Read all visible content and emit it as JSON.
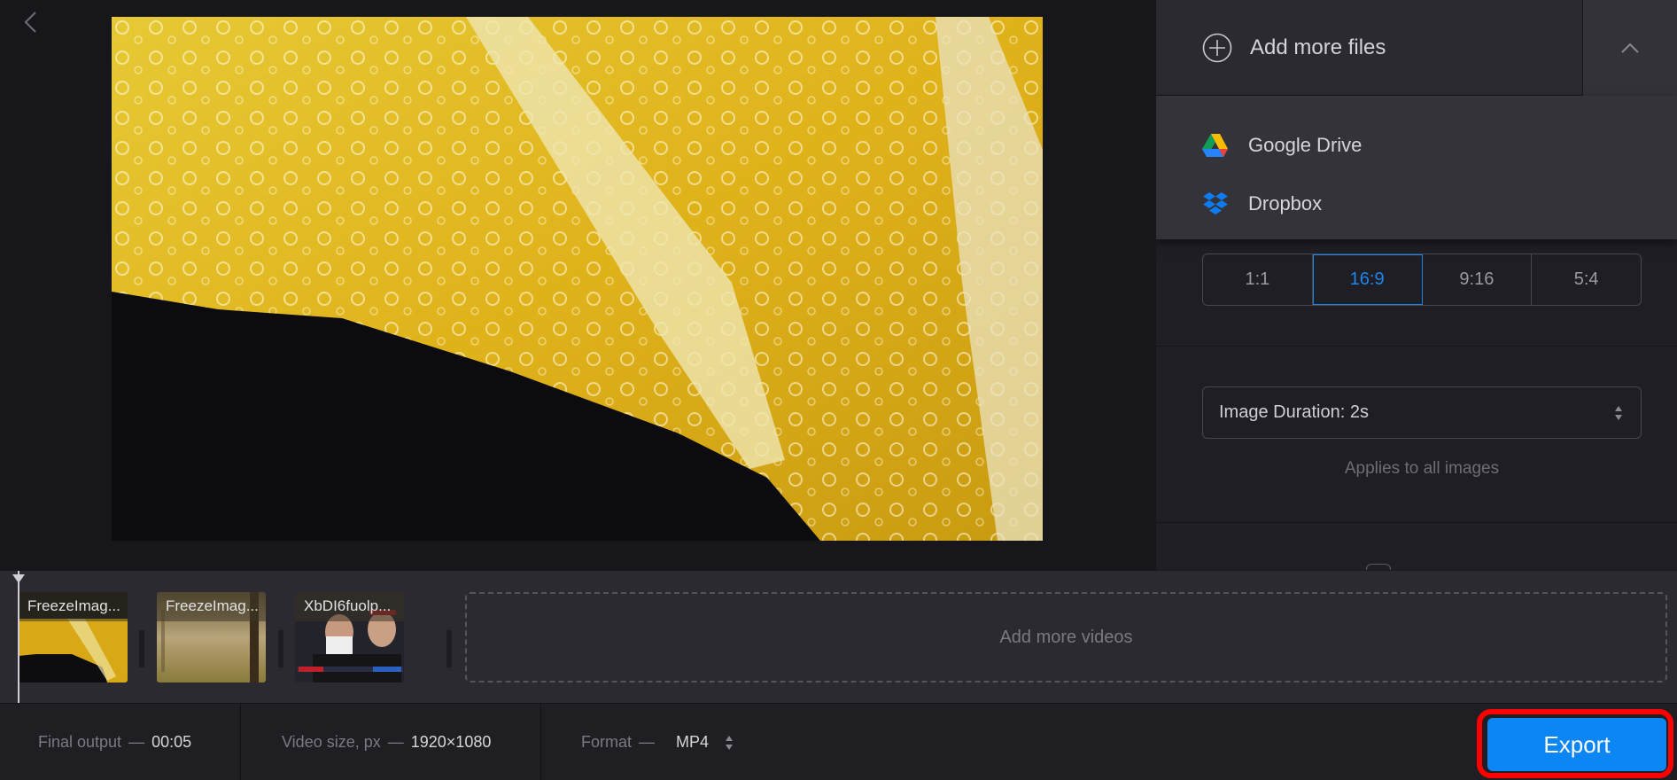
{
  "preview": {
    "back_icon": "chevron-left-icon",
    "image_description": "lemon slices with bubbles"
  },
  "right_panel": {
    "add_files_label": "Add more files",
    "add_files_icon": "plus-circle-icon",
    "collapse_icon": "chevron-up-icon",
    "sources": [
      {
        "label": "Google Drive",
        "icon": "google-drive-icon"
      },
      {
        "label": "Dropbox",
        "icon": "dropbox-icon"
      }
    ],
    "aspect_ratios": [
      {
        "label": "1:1",
        "active": false
      },
      {
        "label": "16:9",
        "active": true
      },
      {
        "label": "9:16",
        "active": false
      },
      {
        "label": "5:4",
        "active": false
      }
    ],
    "image_duration": "Image Duration: 2s",
    "applies_note": "Applies to all images"
  },
  "timeline": {
    "clips": [
      {
        "name": "FreezeImag...",
        "kind": "lemon"
      },
      {
        "name": "FreezeImag...",
        "kind": "forest"
      },
      {
        "name": "XbDI6fuolp...",
        "kind": "basketball"
      }
    ],
    "add_more_label": "Add more videos"
  },
  "bottom_bar": {
    "final_output_label": "Final output",
    "final_output_value": "00:05",
    "video_size_label": "Video size, px",
    "video_size_value": "1920×1080",
    "format_label": "Format",
    "format_value": "MP4",
    "dash": "—",
    "export_label": "Export"
  },
  "colors": {
    "accent": "#0c86f5",
    "active_ratio": "#1b86f0",
    "highlight": "#ff0000"
  }
}
